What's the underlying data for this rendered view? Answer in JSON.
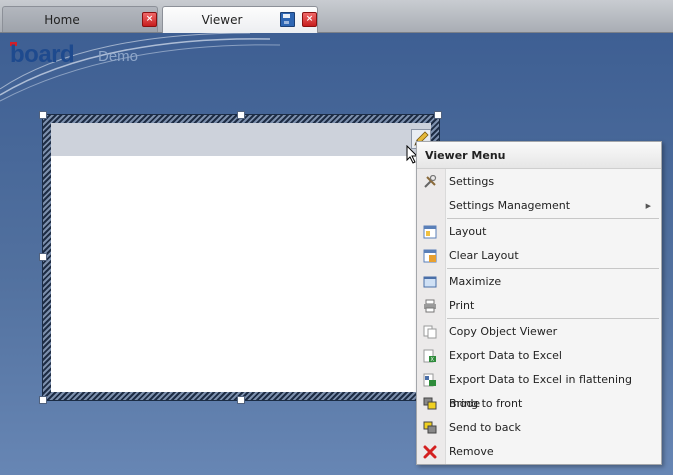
{
  "tabs": [
    {
      "label": "Home",
      "active": false
    },
    {
      "label": "Viewer",
      "active": true
    }
  ],
  "logo": {
    "brand": "board",
    "sub": "Demo"
  },
  "menu": {
    "title": "Viewer Menu",
    "items": [
      {
        "label": "Settings",
        "icon": "tools-icon"
      },
      {
        "label": "Settings Management",
        "icon": "none",
        "submenu": true
      },
      {
        "label": "Layout",
        "icon": "layout-icon"
      },
      {
        "label": "Clear Layout",
        "icon": "clear-layout-icon"
      },
      {
        "label": "Maximize",
        "icon": "maximize-icon"
      },
      {
        "label": "Print",
        "icon": "printer-icon"
      },
      {
        "label": "Copy Object Viewer",
        "icon": "copy-icon"
      },
      {
        "label": "Export Data to Excel",
        "icon": "excel-export-icon"
      },
      {
        "label": "Export Data to Excel in flattening mode",
        "icon": "excel-flatten-icon"
      },
      {
        "label": "Bring to front",
        "icon": "bring-front-icon"
      },
      {
        "label": "Send to back",
        "icon": "send-back-icon"
      },
      {
        "label": "Remove",
        "icon": "remove-icon"
      }
    ]
  },
  "colors": {
    "accent": "#1e4a8e",
    "canvas": "#52719f",
    "close": "#c71d1d"
  }
}
